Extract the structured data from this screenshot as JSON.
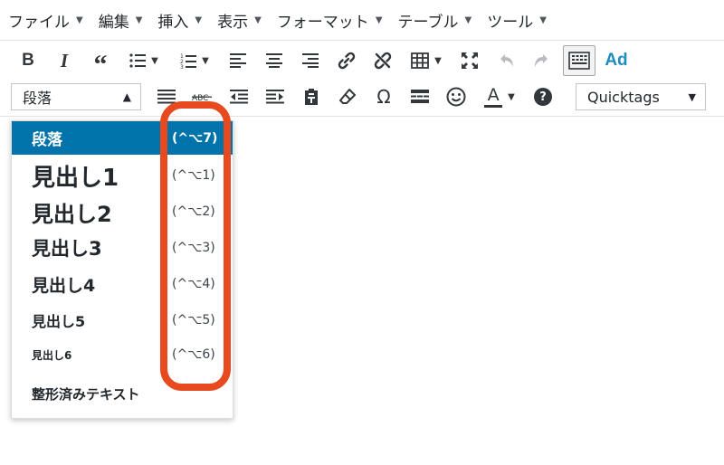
{
  "menubar": {
    "items": [
      {
        "label": "ファイル"
      },
      {
        "label": "編集"
      },
      {
        "label": "挿入"
      },
      {
        "label": "表示"
      },
      {
        "label": "フォーマット"
      },
      {
        "label": "テーブル"
      },
      {
        "label": "ツール"
      }
    ]
  },
  "toolbar1": {
    "icons": [
      "bold-icon",
      "italic-icon",
      "blockquote-icon",
      "bullet-list-icon",
      "numbered-list-icon",
      "align-left-icon",
      "align-center-icon",
      "align-right-icon",
      "link-icon",
      "unlink-icon",
      "table-icon",
      "fullscreen-icon",
      "undo-icon",
      "redo-icon",
      "toolbar-toggle-icon",
      "ad-icon"
    ],
    "bold_glyph": "B",
    "italic_glyph": "I",
    "quote_glyph": "“",
    "ad_label": "Ad"
  },
  "toolbar2": {
    "format_value": "段落",
    "quicktags_value": "Quicktags",
    "omega_glyph": "Ω",
    "help_glyph": "?",
    "textcolor_glyph": "A"
  },
  "format_dropdown": {
    "items": [
      {
        "label": "段落",
        "shortcut": "(^⌥7)",
        "selected": true
      },
      {
        "label": "見出し1",
        "shortcut": "(^⌥1)"
      },
      {
        "label": "見出し2",
        "shortcut": "(^⌥2)"
      },
      {
        "label": "見出し3",
        "shortcut": "(^⌥3)"
      },
      {
        "label": "見出し4",
        "shortcut": "(^⌥4)"
      },
      {
        "label": "見出し5",
        "shortcut": "(^⌥5)"
      },
      {
        "label": "見出し6",
        "shortcut": "(^⌥6)"
      },
      {
        "label": "整形済みテキスト",
        "shortcut": ""
      }
    ]
  },
  "colors": {
    "selected_row": "#0073aa",
    "highlight": "#e84a1f",
    "ad_blue": "#1e8cbe"
  }
}
